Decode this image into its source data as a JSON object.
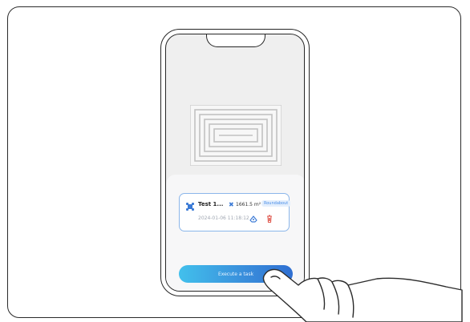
{
  "task_card": {
    "name": "Test 1...",
    "area": "1661.5 m²",
    "mode_badge": "Roundabout",
    "timestamp": "2024-01-06 11:18:12"
  },
  "execute_button_label": "Execute a task",
  "colors": {
    "accent_blue": "#3a90dc",
    "delete_red": "#e05a50",
    "card_border": "#8bb6ea"
  },
  "icons": [
    "mower-icon",
    "area-icon",
    "edit-icon",
    "delete-icon",
    "hand-pointer-icon"
  ]
}
